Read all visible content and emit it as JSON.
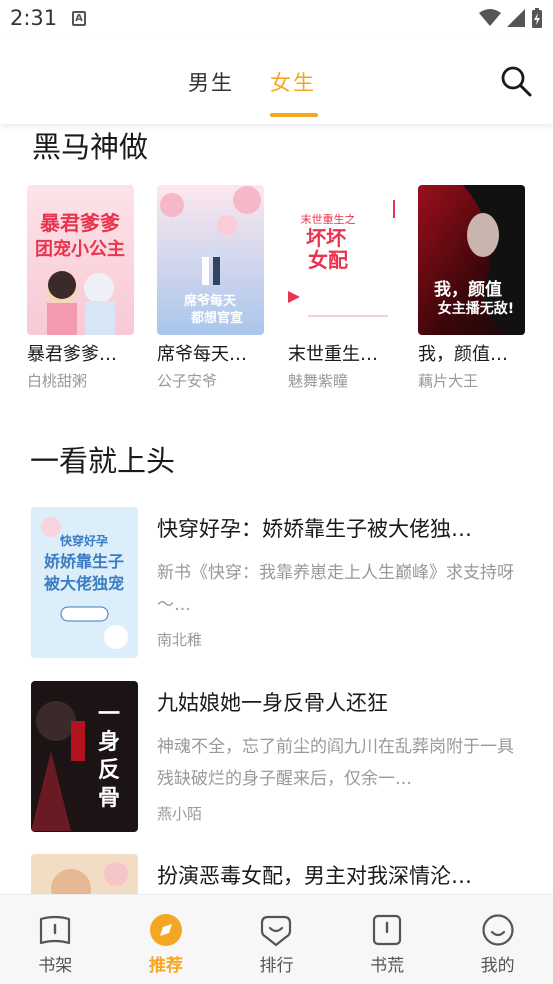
{
  "status_bar": {
    "time": "2:31",
    "notif_letter": "A"
  },
  "header": {
    "tabs": [
      {
        "label": "男生",
        "active": false
      },
      {
        "label": "女生",
        "active": true
      }
    ],
    "accent_color": "#f5a623"
  },
  "section1": {
    "title": "黑马神做",
    "books": [
      {
        "title": "暴君爹爹…",
        "author": "白桃甜粥",
        "cover_text": "暴君爹爹团宠小公主"
      },
      {
        "title": "席爷每天…",
        "author": "公子安爷",
        "cover_text": "席爷每天都想官宣"
      },
      {
        "title": "末世重生…",
        "author": "魅舞紫瞳",
        "cover_text": "坏坏女配"
      },
      {
        "title": "我，颜值…",
        "author": "藕片大王",
        "cover_text": "我，颜值女主播无敌！"
      }
    ]
  },
  "section2": {
    "title": "一看就上头",
    "books": [
      {
        "title": "快穿好孕：娇娇靠生子被大佬独…",
        "desc": "新书《快穿：我靠养崽走上人生巅峰》求支持呀～…",
        "author": "南北稚",
        "cover_text": "娇娇靠生子被大佬独宠"
      },
      {
        "title": "九姑娘她一身反骨人还狂",
        "desc": "神魂不全，忘了前尘的阎九川在乱葬岗附于一具残缺破烂的身子醒来后，仅余一…",
        "author": "燕小陌",
        "cover_text": "一身反骨人还狂"
      },
      {
        "title": "扮演恶毒女配，男主对我深情沦…",
        "desc": "",
        "author": "",
        "cover_text": ""
      }
    ]
  },
  "bottom_nav": [
    {
      "label": "书架",
      "icon": "book-icon",
      "active": false
    },
    {
      "label": "推荐",
      "icon": "compass-icon",
      "active": true
    },
    {
      "label": "排行",
      "icon": "heart-chat-icon",
      "active": false
    },
    {
      "label": "书荒",
      "icon": "alert-book-icon",
      "active": false
    },
    {
      "label": "我的",
      "icon": "smile-icon",
      "active": false
    }
  ]
}
